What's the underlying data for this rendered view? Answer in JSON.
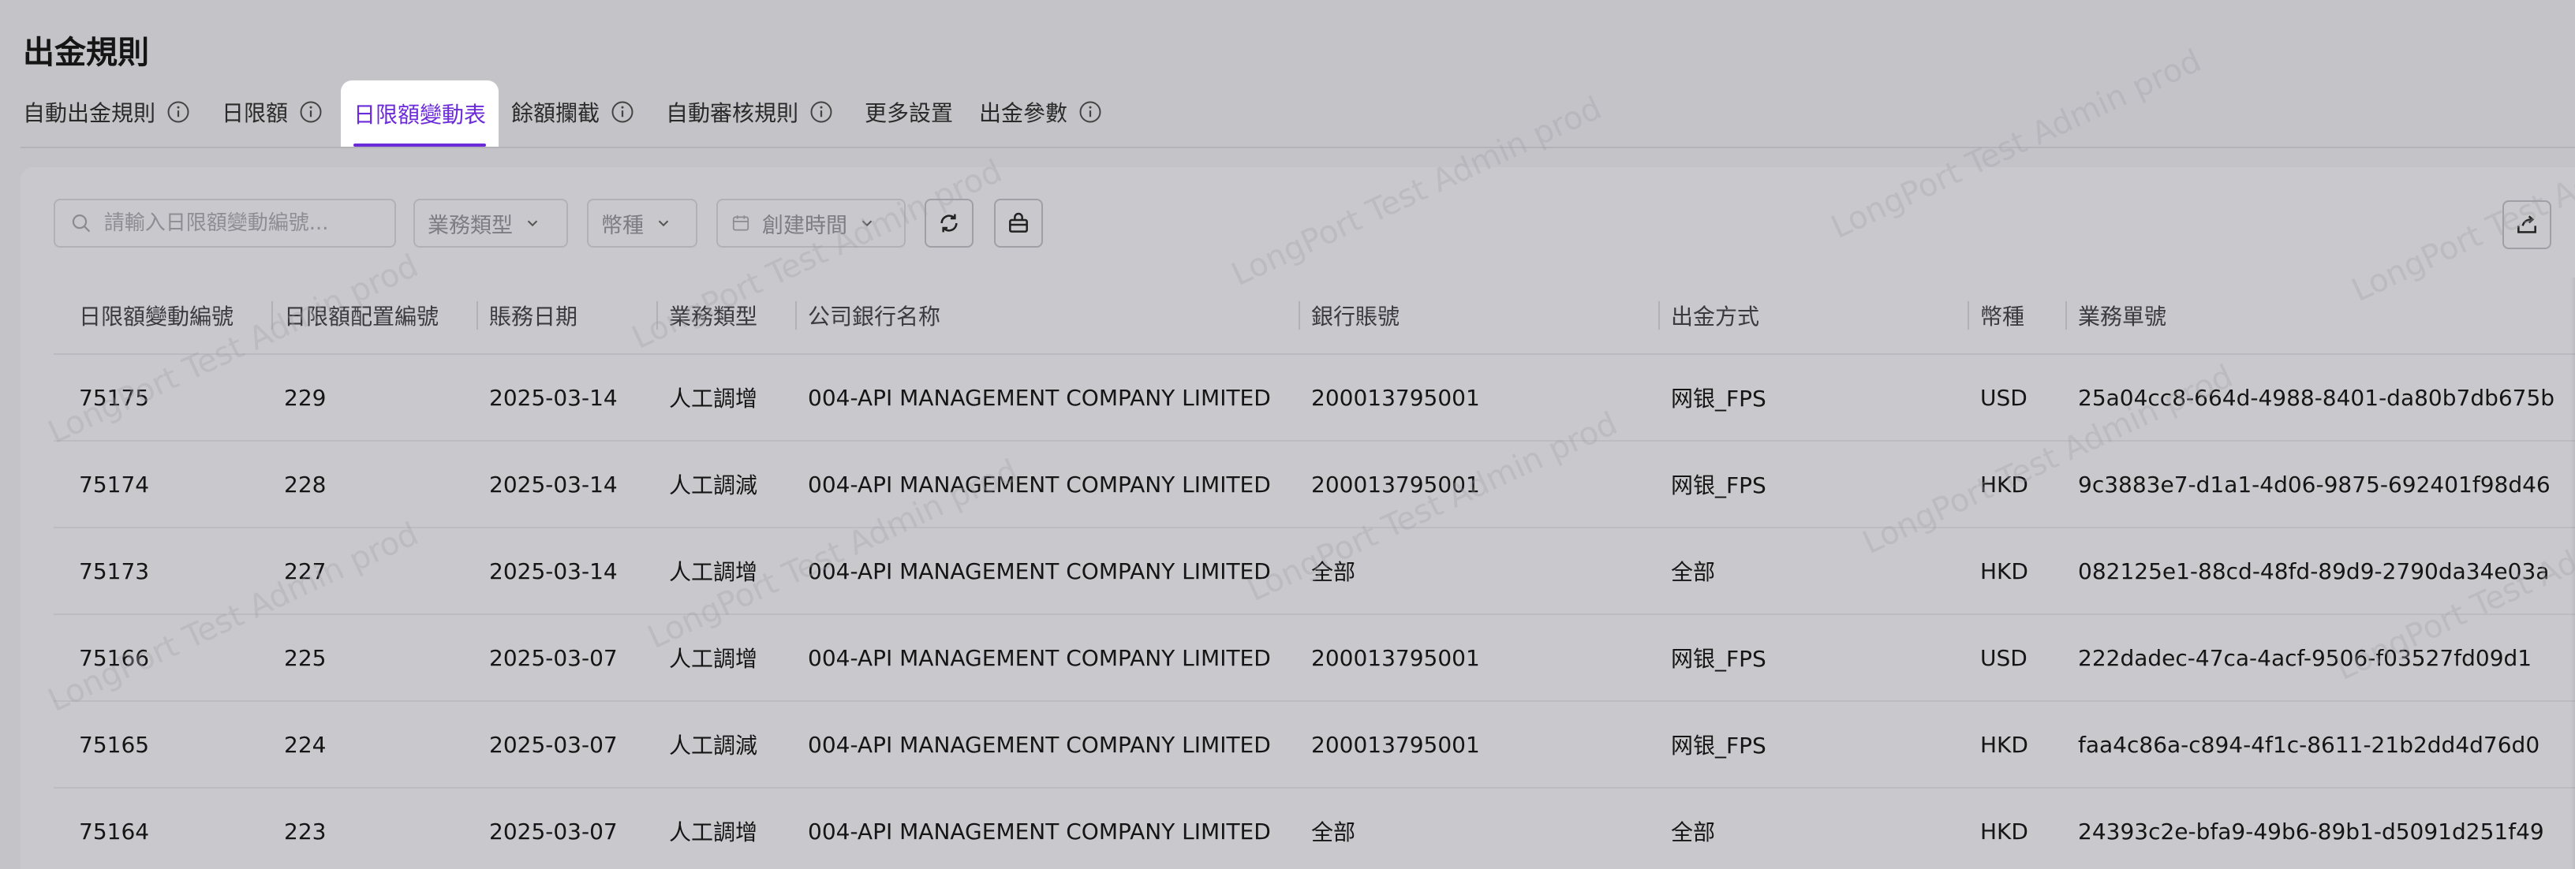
{
  "page": {
    "title": "出金規則"
  },
  "tabs": [
    {
      "label": "自動出金規則",
      "has_info": true
    },
    {
      "label": "日限額",
      "has_info": true
    },
    {
      "label": "日限額變動表",
      "has_info": false,
      "active": true
    },
    {
      "label": "餘額攔截",
      "has_info": true
    },
    {
      "label": "自動審核規則",
      "has_info": true
    },
    {
      "label": "更多設置",
      "has_info": false
    },
    {
      "label": "出金參數",
      "has_info": true
    }
  ],
  "toolbar": {
    "search_placeholder": "請輸入日限額變動編號...",
    "business_type": "業務類型",
    "currency": "幣種",
    "created_time": "創建時間"
  },
  "table": {
    "columns": [
      "日限額變動編號",
      "日限額配置編號",
      "賬務日期",
      "業務類型",
      "公司銀行名称",
      "銀行賬號",
      "出金方式",
      "幣種",
      "業務單號"
    ],
    "rows": [
      [
        "75175",
        "229",
        "2025-03-14",
        "人工調增",
        "004-API MANAGEMENT COMPANY LIMITED",
        "200013795001",
        "网银_FPS",
        "USD",
        "25a04cc8-664d-4988-8401-da80b7db675b"
      ],
      [
        "75174",
        "228",
        "2025-03-14",
        "人工調減",
        "004-API MANAGEMENT COMPANY LIMITED",
        "200013795001",
        "网银_FPS",
        "HKD",
        "9c3883e7-d1a1-4d06-9875-692401f98d46"
      ],
      [
        "75173",
        "227",
        "2025-03-14",
        "人工調增",
        "004-API MANAGEMENT COMPANY LIMITED",
        "全部",
        "全部",
        "HKD",
        "082125e1-88cd-48fd-89d9-2790da34e03a"
      ],
      [
        "75166",
        "225",
        "2025-03-07",
        "人工調增",
        "004-API MANAGEMENT COMPANY LIMITED",
        "200013795001",
        "网银_FPS",
        "USD",
        "222dadec-47ca-4acf-9506-f03527fd09d1"
      ],
      [
        "75165",
        "224",
        "2025-03-07",
        "人工調減",
        "004-API MANAGEMENT COMPANY LIMITED",
        "200013795001",
        "网银_FPS",
        "HKD",
        "faa4c86a-c894-4f1c-8611-21b2dd4d76d0"
      ],
      [
        "75164",
        "223",
        "2025-03-07",
        "人工調增",
        "004-API MANAGEMENT COMPANY LIMITED",
        "全部",
        "全部",
        "HKD",
        "24393c2e-bfa9-49b6-89b1-d5091d251f49"
      ]
    ]
  },
  "watermark": "LongPort Test Admin prod",
  "colors": {
    "accent": "#6c2bd9",
    "overlay": "#c4c4c8"
  },
  "icons": [
    "info-icon",
    "search-icon",
    "chevron-down-icon",
    "calendar-icon",
    "refresh-icon",
    "basket-icon",
    "export-icon"
  ]
}
